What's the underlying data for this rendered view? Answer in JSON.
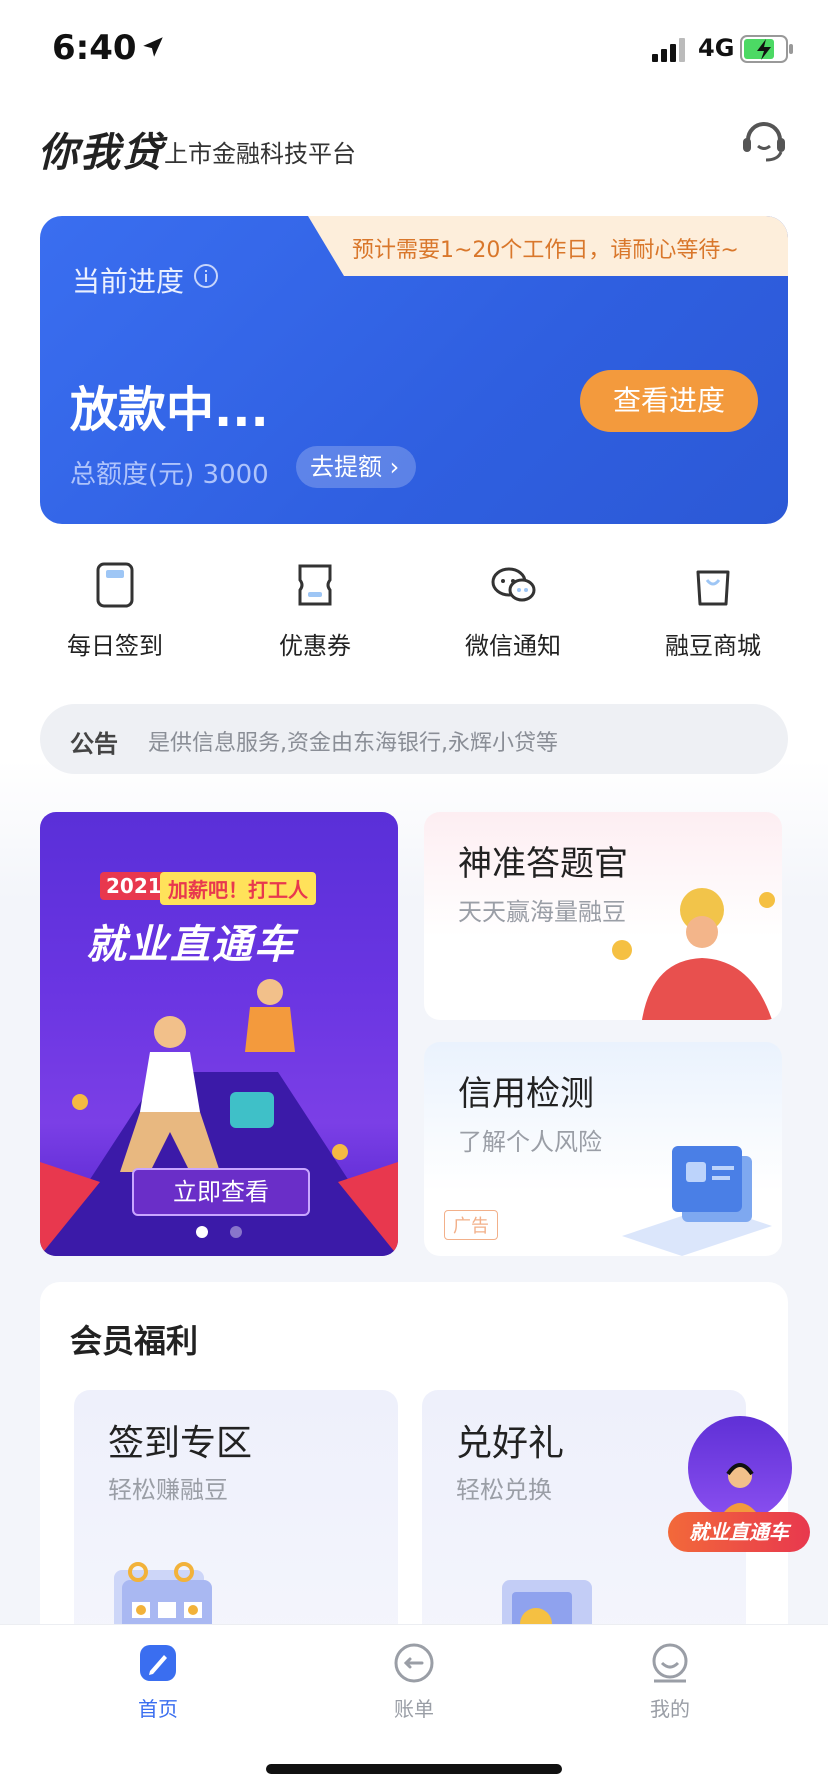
{
  "status_bar": {
    "time": "6:40",
    "network": "4G"
  },
  "header": {
    "logo": "你我贷",
    "subtitle": "上市金融科技平台"
  },
  "progress_card": {
    "tip": "预计需要1~20个工作日，请耐心等待~",
    "label": "当前进度",
    "status": "放款中...",
    "view_button": "查看进度",
    "credit_label": "总额度(元) 3000",
    "withdraw_button": "去提额 ›"
  },
  "quick_entries": [
    {
      "label": "每日签到",
      "icon": "calendar-check-icon"
    },
    {
      "label": "优惠券",
      "icon": "coupon-icon"
    },
    {
      "label": "微信通知",
      "icon": "wechat-icon"
    },
    {
      "label": "融豆商城",
      "icon": "shopping-bag-icon"
    }
  ],
  "notice": {
    "tag": "公告",
    "text": "是供信息服务,资金由东海银行,永辉小贷等"
  },
  "banner": {
    "year": "2021",
    "tagline": "加薪吧！打工人",
    "title": "就业直通车",
    "cta": "立即查看"
  },
  "quiz_card": {
    "title": "神准答题官",
    "subtitle": "天天赢海量融豆"
  },
  "credit_card": {
    "title": "信用检测",
    "subtitle": "了解个人风险",
    "ad": "广告"
  },
  "benefits": {
    "title": "会员福利",
    "cards": [
      {
        "title": "签到专区",
        "subtitle": "轻松赚融豆"
      },
      {
        "title": "兑好礼",
        "subtitle": "轻松兑换"
      }
    ]
  },
  "floating": {
    "label": "就业直通车"
  },
  "tabs": [
    {
      "label": "首页",
      "active": true
    },
    {
      "label": "账单",
      "active": false
    },
    {
      "label": "我的",
      "active": false
    }
  ],
  "colors": {
    "primary": "#2f5fe0",
    "accent": "#f39a3d",
    "tab_active": "#3a6ef0",
    "tab_inactive": "#9a9ea6"
  }
}
